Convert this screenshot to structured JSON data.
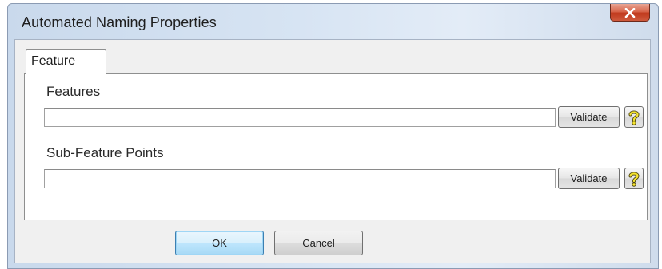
{
  "window": {
    "title": "Automated Naming Properties",
    "close_label": "x"
  },
  "tabs": [
    {
      "label": "Feature",
      "selected": true
    }
  ],
  "fields": [
    {
      "label": "Features",
      "value": "",
      "validate_label": "Validate",
      "help_icon": "question-mark-icon"
    },
    {
      "label": "Sub-Feature Points",
      "value": "",
      "validate_label": "Validate",
      "help_icon": "question-mark-icon"
    }
  ],
  "buttons": {
    "ok_label": "OK",
    "cancel_label": "Cancel"
  },
  "colors": {
    "ok_border": "#3c7fb1",
    "close_red": "#c0391d",
    "help_yellow": "#f5e430"
  }
}
